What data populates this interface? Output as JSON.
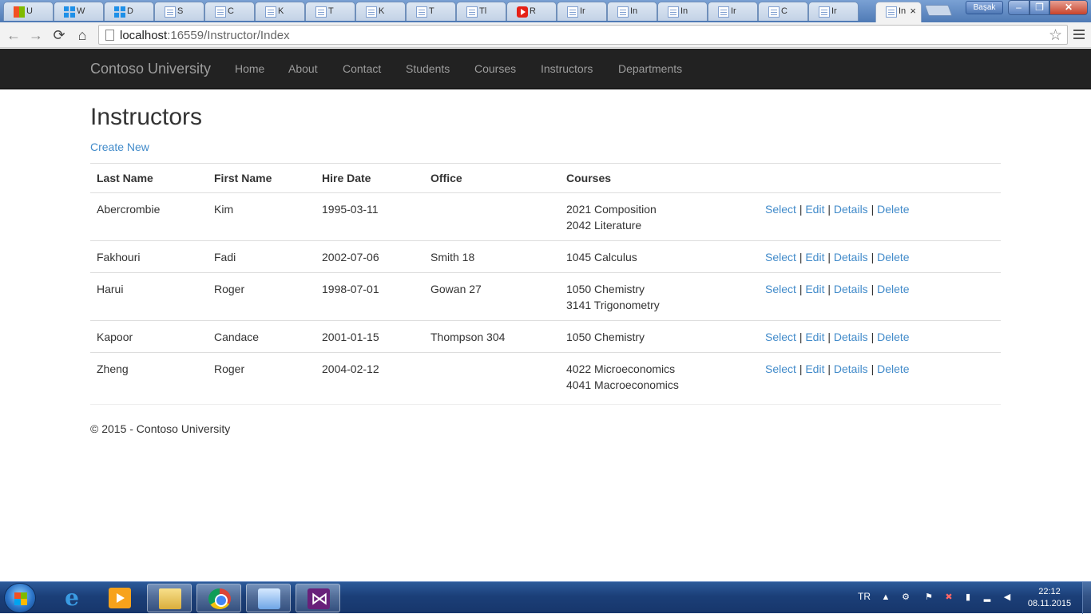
{
  "browser": {
    "tabs": [
      {
        "icon": "ms-favicon",
        "title": "U"
      },
      {
        "icon": "windows-favicon",
        "title": "W"
      },
      {
        "icon": "windows-favicon",
        "title": "D"
      },
      {
        "icon": "doc-favicon",
        "title": "S"
      },
      {
        "icon": "doc-favicon",
        "title": "C"
      },
      {
        "icon": "doc-favicon",
        "title": "K"
      },
      {
        "icon": "doc-favicon",
        "title": "T"
      },
      {
        "icon": "doc-favicon",
        "title": "K"
      },
      {
        "icon": "doc-favicon",
        "title": "T"
      },
      {
        "icon": "doc-favicon",
        "title": "Tl"
      },
      {
        "icon": "youtube-favicon",
        "title": "R"
      },
      {
        "icon": "doc-favicon",
        "title": "Ir"
      },
      {
        "icon": "doc-favicon",
        "title": "In"
      },
      {
        "icon": "doc-favicon",
        "title": "In"
      },
      {
        "icon": "doc-favicon",
        "title": "Ir"
      },
      {
        "icon": "doc-favicon",
        "title": "C"
      },
      {
        "icon": "doc-favicon",
        "title": "Ir"
      }
    ],
    "active_tab": {
      "title": "In",
      "close": "×"
    },
    "user_button": "Başak",
    "window_buttons": {
      "minimize": "–",
      "maximize": "❐",
      "close": "✕"
    },
    "nav": {
      "back": "←",
      "forward": "→",
      "reload": "⟳",
      "home": "⌂"
    },
    "address": {
      "host": "localhost",
      "rest": ":16559/Instructor/Index"
    },
    "star": "☆"
  },
  "site": {
    "brand": "Contoso University",
    "nav_links": [
      "Home",
      "About",
      "Contact",
      "Students",
      "Courses",
      "Instructors",
      "Departments"
    ]
  },
  "page": {
    "title": "Instructors",
    "create_link": "Create New",
    "table": {
      "headers": [
        "Last Name",
        "First Name",
        "Hire Date",
        "Office",
        "Courses"
      ],
      "rows": [
        {
          "last": "Abercrombie",
          "first": "Kim",
          "hire": "1995-03-11",
          "office": "",
          "courses": [
            "2021 Composition",
            "2042 Literature"
          ]
        },
        {
          "last": "Fakhouri",
          "first": "Fadi",
          "hire": "2002-07-06",
          "office": "Smith 18",
          "courses": [
            "1045 Calculus"
          ]
        },
        {
          "last": "Harui",
          "first": "Roger",
          "hire": "1998-07-01",
          "office": "Gowan 27",
          "courses": [
            "1050 Chemistry",
            "3141 Trigonometry"
          ]
        },
        {
          "last": "Kapoor",
          "first": "Candace",
          "hire": "2001-01-15",
          "office": "Thompson 304",
          "courses": [
            "1050 Chemistry"
          ]
        },
        {
          "last": "Zheng",
          "first": "Roger",
          "hire": "2004-02-12",
          "office": "",
          "courses": [
            "4022 Microeconomics",
            "4041 Macroeconomics"
          ]
        }
      ],
      "actions": {
        "select": "Select",
        "edit": "Edit",
        "details": "Details",
        "delete": "Delete",
        "separator": "|"
      }
    },
    "footer": "© 2015 - Contoso University"
  },
  "taskbar": {
    "apps": [
      "internet-explorer-icon",
      "media-player-icon",
      "file-explorer-icon",
      "chrome-icon",
      "fiddler-icon",
      "visual-studio-icon"
    ],
    "language": "TR",
    "clock": {
      "time": "22:12",
      "date": "08.11.2015"
    }
  },
  "colors": {
    "link": "#428bca",
    "navbar": "#222222",
    "navbar_text": "#9d9d9d"
  }
}
